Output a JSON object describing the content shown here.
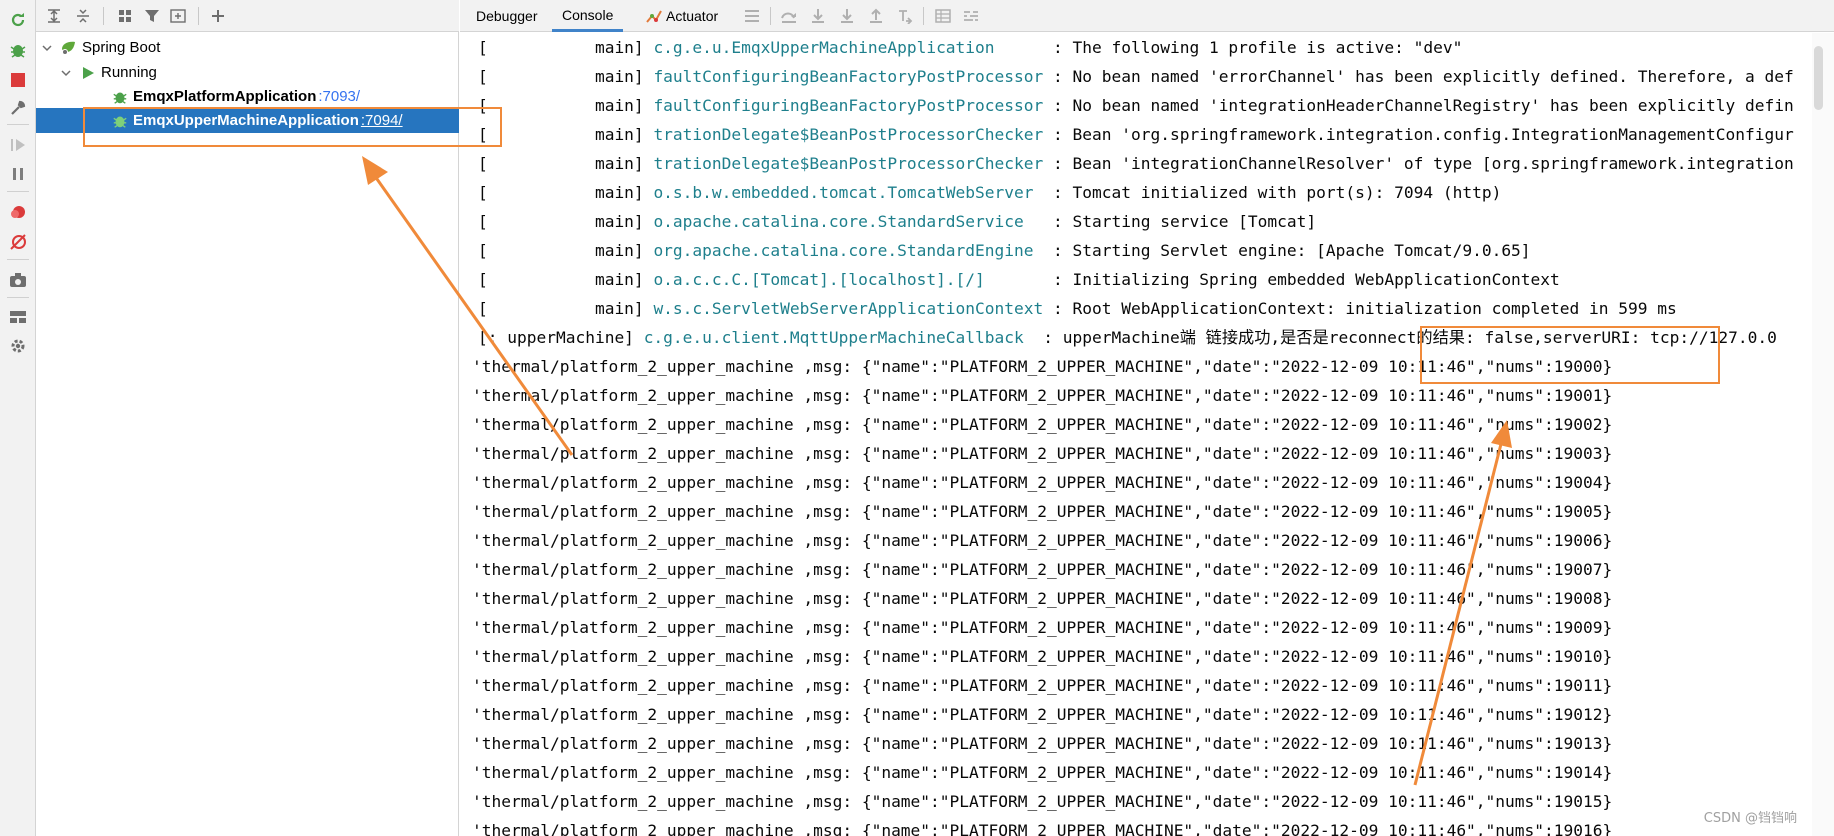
{
  "tree": {
    "root": {
      "label": "Spring Boot"
    },
    "group": {
      "label": "Running"
    },
    "apps": [
      {
        "name": "EmqxPlatformApplication",
        "port": ":7093/",
        "selected": false
      },
      {
        "name": "EmqxUpperMachineApplication",
        "port": ":7094/",
        "selected": true
      }
    ]
  },
  "tabs": [
    {
      "label": "Debugger",
      "active": false
    },
    {
      "label": "Console",
      "active": true
    },
    {
      "label": "Actuator",
      "active": false
    }
  ],
  "log_lines": [
    {
      "prefix": "[           main] ",
      "logger": "c.g.e.u.EmqxUpperMachineApplication     ",
      "message": " : The following 1 profile is active: \"dev\""
    },
    {
      "prefix": "[           main] ",
      "logger": "faultConfiguringBeanFactoryPostProcessor",
      "message": " : No bean named 'errorChannel' has been explicitly defined. Therefore, a def"
    },
    {
      "prefix": "[           main] ",
      "logger": "faultConfiguringBeanFactoryPostProcessor",
      "message": " : No bean named 'integrationHeaderChannelRegistry' has been explicitly defin"
    },
    {
      "prefix": "[           main] ",
      "logger": "trationDelegate$BeanPostProcessorChecker",
      "message": " : Bean 'org.springframework.integration.config.IntegrationManagementConfigur"
    },
    {
      "prefix": "[           main] ",
      "logger": "trationDelegate$BeanPostProcessorChecker",
      "message": " : Bean 'integrationChannelResolver' of type [org.springframework.integration"
    },
    {
      "prefix": "[           main] ",
      "logger": "o.s.b.w.embedded.tomcat.TomcatWebServer ",
      "message": " : Tomcat initialized with port(s): 7094 (http)"
    },
    {
      "prefix": "[           main] ",
      "logger": "o.apache.catalina.core.StandardService  ",
      "message": " : Starting service [Tomcat]"
    },
    {
      "prefix": "[           main] ",
      "logger": "org.apache.catalina.core.StandardEngine ",
      "message": " : Starting Servlet engine: [Apache Tomcat/9.0.65]"
    },
    {
      "prefix": "[           main] ",
      "logger": "o.a.c.c.C.[Tomcat].[localhost].[/]      ",
      "message": " : Initializing Spring embedded WebApplicationContext"
    },
    {
      "prefix": "[           main] ",
      "logger": "w.s.c.ServletWebServerApplicationContext",
      "message": " : Root WebApplicationContext: initialization completed in 599 ms"
    },
    {
      "prefix": "[: upperMachine] ",
      "logger": "c.g.e.u.client.MqttUpperMachineCallback ",
      "message": " : upperMachine端 链接成功,是否是reconnect的结果: false,serverURI: tcp://127.0.0"
    },
    {
      "prefix": "",
      "logger": "",
      "message": "'thermal/platform_2_upper_machine ,msg: {\"name\":\"PLATFORM_2_UPPER_MACHINE\",\"date\":\"2022-12-09 10:11:46\",\"nums\":19000}"
    },
    {
      "prefix": "",
      "logger": "",
      "message": "'thermal/platform_2_upper_machine ,msg: {\"name\":\"PLATFORM_2_UPPER_MACHINE\",\"date\":\"2022-12-09 10:11:46\",\"nums\":19001}"
    },
    {
      "prefix": "",
      "logger": "",
      "message": "'thermal/platform_2_upper_machine ,msg: {\"name\":\"PLATFORM_2_UPPER_MACHINE\",\"date\":\"2022-12-09 10:11:46\",\"nums\":19002}"
    },
    {
      "prefix": "",
      "logger": "",
      "message": "'thermal/platform_2_upper_machine ,msg: {\"name\":\"PLATFORM_2_UPPER_MACHINE\",\"date\":\"2022-12-09 10:11:46\",\"nums\":19003}"
    },
    {
      "prefix": "",
      "logger": "",
      "message": "'thermal/platform_2_upper_machine ,msg: {\"name\":\"PLATFORM_2_UPPER_MACHINE\",\"date\":\"2022-12-09 10:11:46\",\"nums\":19004}"
    },
    {
      "prefix": "",
      "logger": "",
      "message": "'thermal/platform_2_upper_machine ,msg: {\"name\":\"PLATFORM_2_UPPER_MACHINE\",\"date\":\"2022-12-09 10:11:46\",\"nums\":19005}"
    },
    {
      "prefix": "",
      "logger": "",
      "message": "'thermal/platform_2_upper_machine ,msg: {\"name\":\"PLATFORM_2_UPPER_MACHINE\",\"date\":\"2022-12-09 10:11:46\",\"nums\":19006}"
    },
    {
      "prefix": "",
      "logger": "",
      "message": "'thermal/platform_2_upper_machine ,msg: {\"name\":\"PLATFORM_2_UPPER_MACHINE\",\"date\":\"2022-12-09 10:11:46\",\"nums\":19007}"
    },
    {
      "prefix": "",
      "logger": "",
      "message": "'thermal/platform_2_upper_machine ,msg: {\"name\":\"PLATFORM_2_UPPER_MACHINE\",\"date\":\"2022-12-09 10:11:46\",\"nums\":19008}"
    },
    {
      "prefix": "",
      "logger": "",
      "message": "'thermal/platform_2_upper_machine ,msg: {\"name\":\"PLATFORM_2_UPPER_MACHINE\",\"date\":\"2022-12-09 10:11:46\",\"nums\":19009}"
    },
    {
      "prefix": "",
      "logger": "",
      "message": "'thermal/platform_2_upper_machine ,msg: {\"name\":\"PLATFORM_2_UPPER_MACHINE\",\"date\":\"2022-12-09 10:11:46\",\"nums\":19010}"
    },
    {
      "prefix": "",
      "logger": "",
      "message": "'thermal/platform_2_upper_machine ,msg: {\"name\":\"PLATFORM_2_UPPER_MACHINE\",\"date\":\"2022-12-09 10:11:46\",\"nums\":19011}"
    },
    {
      "prefix": "",
      "logger": "",
      "message": "'thermal/platform_2_upper_machine ,msg: {\"name\":\"PLATFORM_2_UPPER_MACHINE\",\"date\":\"2022-12-09 10:11:46\",\"nums\":19012}"
    },
    {
      "prefix": "",
      "logger": "",
      "message": "'thermal/platform_2_upper_machine ,msg: {\"name\":\"PLATFORM_2_UPPER_MACHINE\",\"date\":\"2022-12-09 10:11:46\",\"nums\":19013}"
    },
    {
      "prefix": "",
      "logger": "",
      "message": "'thermal/platform_2_upper_machine ,msg: {\"name\":\"PLATFORM_2_UPPER_MACHINE\",\"date\":\"2022-12-09 10:11:46\",\"nums\":19014}"
    },
    {
      "prefix": "",
      "logger": "",
      "message": "'thermal/platform_2_upper_machine ,msg: {\"name\":\"PLATFORM_2_UPPER_MACHINE\",\"date\":\"2022-12-09 10:11:46\",\"nums\":19015}"
    },
    {
      "prefix": "",
      "logger": "",
      "message": "'thermal/platform_2_upper_machine ,msg: {\"name\":\"PLATFORM_2_UPPER_MACHINE\",\"date\":\"2022-12-09 10:11:46\",\"nums\":19016}"
    }
  ],
  "watermark": "CSDN @铛铛响",
  "colors": {
    "selection": "#2675bf",
    "logger": "#1e7f8c",
    "annotation": "#f08a3a",
    "spring_green": "#5fa83a",
    "run_green": "#4ca14a",
    "stop_red": "#db3b3b"
  },
  "icons": {
    "left_strip": [
      "rerun-icon",
      "debug-icon",
      "stop-icon",
      "wrench-icon",
      "resume-icon",
      "pause-icon",
      "breakpoint-icon",
      "mute-breakpoints-icon",
      "camera-icon",
      "layout-icon",
      "settings-icon"
    ],
    "tree_toolbar": [
      "expand-all-icon",
      "collapse-all-icon",
      "group-by-icon",
      "filter-icon",
      "new-group-icon",
      "add-service-icon"
    ],
    "tab_toolbar": [
      "actuator-icon",
      "menu-icon",
      "step-over-icon",
      "step-into-icon",
      "force-step-into-icon",
      "step-out-icon",
      "run-to-cursor-icon",
      "table-icon",
      "trace-icon"
    ]
  }
}
